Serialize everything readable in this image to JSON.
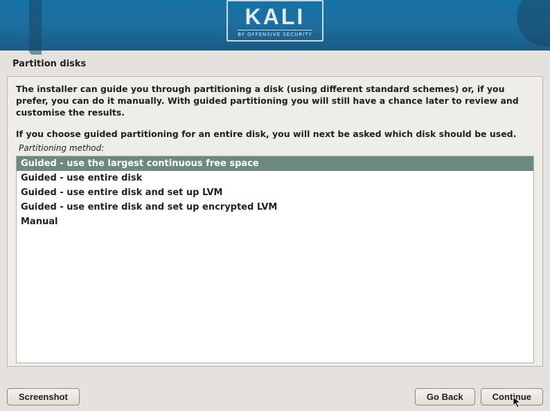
{
  "brand": {
    "name": "KALI",
    "tagline": "BY OFFENSIVE SECURITY"
  },
  "page_title": "Partition disks",
  "body": {
    "p1": "The installer can guide you through partitioning a disk (using different standard schemes) or, if you prefer, you can do it manually. With guided partitioning you will still have a chance later to review and customise the results.",
    "p2": "If you choose guided partitioning for an entire disk, you will next be asked which disk should be used.",
    "method_label": "Partitioning method:"
  },
  "options": [
    {
      "label": "Guided - use the largest continuous free space",
      "selected": true
    },
    {
      "label": "Guided - use entire disk",
      "selected": false
    },
    {
      "label": "Guided - use entire disk and set up LVM",
      "selected": false
    },
    {
      "label": "Guided - use entire disk and set up encrypted LVM",
      "selected": false
    },
    {
      "label": "Manual",
      "selected": false
    }
  ],
  "buttons": {
    "screenshot": "Screenshot",
    "go_back": "Go Back",
    "continue": "Continue"
  }
}
